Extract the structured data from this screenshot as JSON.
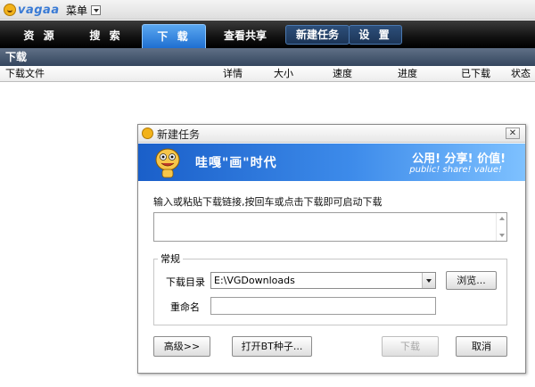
{
  "app": {
    "logo_text": "vagaa",
    "menu_label": "菜单"
  },
  "tabs": [
    {
      "label": "资 源"
    },
    {
      "label": "搜 索"
    },
    {
      "label": "下 载"
    },
    {
      "label": "查看共享"
    },
    {
      "label": "新建任务"
    },
    {
      "label": "设 置"
    }
  ],
  "active_tab": "下 载",
  "section_title": "下载",
  "columns": [
    "下载文件",
    "详情",
    "大小",
    "速度",
    "进度",
    "已下载",
    "状态"
  ],
  "dialog": {
    "title": "新建任务",
    "close_glyph": "✕",
    "banner": {
      "slogan": "哇嘎\"画\"时代",
      "right_line1": "公用! 分享! 价值!",
      "right_line2": "public! share! value!"
    },
    "instruction": "输入或粘贴下载链接,按回车或点击下载即可启动下载",
    "link_input_value": "",
    "group_label": "常规",
    "download_dir_label": "下载目录",
    "download_dir_value": "E:\\VGDownloads",
    "browse_button": "浏览...",
    "rename_label": "重命名",
    "rename_value": "",
    "advanced_button": "高级>>",
    "open_bt_button": "打开BT种子...",
    "download_button": "下载",
    "cancel_button": "取消"
  },
  "colors": {
    "tabbar": "#111111",
    "active_tab": "#1f6fd1",
    "banner": "#1a5fc9"
  }
}
